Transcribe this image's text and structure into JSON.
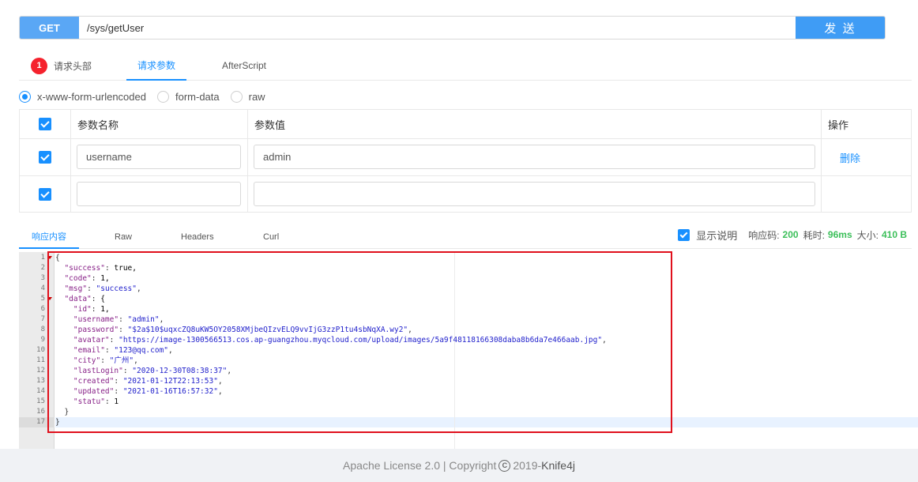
{
  "request": {
    "method": "GET",
    "url": "/sys/getUser",
    "send_label": "发 送"
  },
  "req_tabs": [
    {
      "label": "请求头部",
      "badge": "1"
    },
    {
      "label": "请求参数"
    },
    {
      "label": "AfterScript"
    }
  ],
  "body_types": [
    "x-www-form-urlencoded",
    "form-data",
    "raw"
  ],
  "params_table": {
    "headers": [
      "参数名称",
      "参数值",
      "操作"
    ],
    "rows": [
      {
        "name": "username",
        "value": "admin",
        "action": "删除"
      },
      {
        "name": "",
        "value": "",
        "action": ""
      }
    ]
  },
  "resp_tabs": [
    "响应内容",
    "Raw",
    "Headers",
    "Curl"
  ],
  "resp_meta": {
    "show_desc": "显示说明",
    "status_label": "响应码:",
    "status": "200",
    "time_label": "耗时:",
    "time": "96ms",
    "size_label": "大小:",
    "size": "410 B"
  },
  "code_lines": [
    "{",
    "  \"success\": true,",
    "  \"code\": 1,",
    "  \"msg\": \"success\",",
    "  \"data\": {",
    "    \"id\": 1,",
    "    \"username\": \"admin\",",
    "    \"password\": \"$2a$10$uqxcZQ8uKW5OY2058XMjbeQIzvELQ9vvIjG3zzP1tu4sbNqXA.wy2\",",
    "    \"avatar\": \"https://image-1300566513.cos.ap-guangzhou.myqcloud.com/upload/images/5a9f48118166308daba8b6da7e466aab.jpg\",",
    "    \"email\": \"123@qq.com\",",
    "    \"city\": \"广州\",",
    "    \"lastLogin\": \"2020-12-30T08:38:37\",",
    "    \"created\": \"2021-01-12T22:13:53\",",
    "    \"updated\": \"2021-01-16T16:57:32\",",
    "    \"statu\": 1",
    "  }",
    "}"
  ],
  "footer": {
    "license": "Apache License 2.0 | Copyright ",
    "year": " 2019-",
    "brand": "Knife4j"
  },
  "colors": {
    "accent": "#1890ff",
    "method_bg": "#5aa7f5",
    "highlight_box": "#e0101c",
    "success_green": "#3cbf5a"
  }
}
